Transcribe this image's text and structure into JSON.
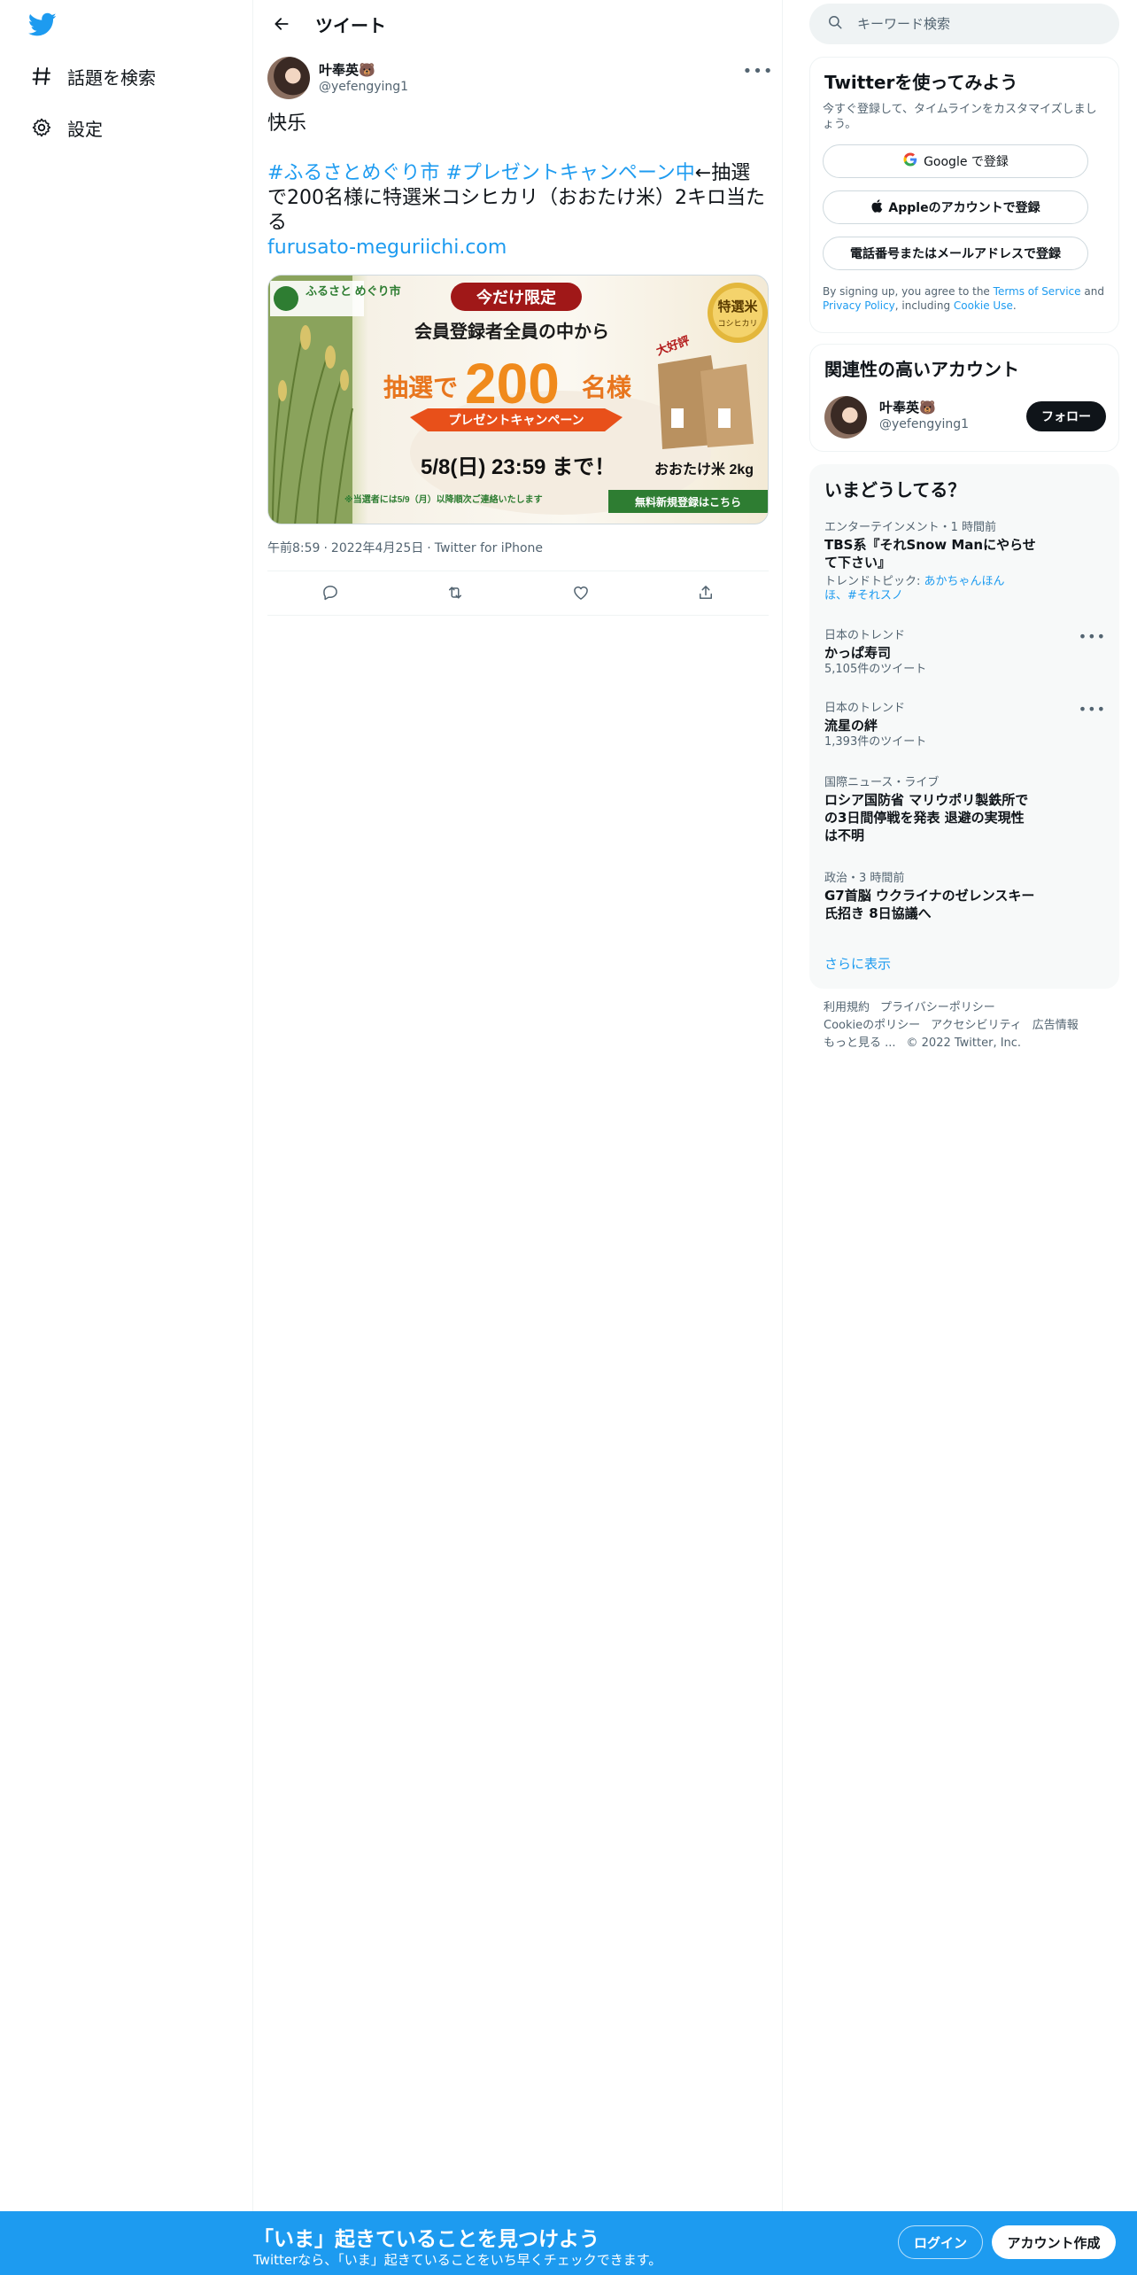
{
  "colors": {
    "brand": "#1d9bf0",
    "text": "#0f1419",
    "muted": "#536471",
    "border": "#eff3f4"
  },
  "nav": {
    "logo_icon": "twitter-bird-icon",
    "items": [
      {
        "icon": "hashtag-icon",
        "label": "話題を検索"
      },
      {
        "icon": "gear-icon",
        "label": "設定"
      }
    ]
  },
  "header": {
    "back_icon": "arrow-left-icon",
    "title": "ツイート"
  },
  "tweet": {
    "author_name": "叶奉英🐻",
    "author_handle": "@yefengying1",
    "more_icon": "more-icon",
    "line1": "快乐",
    "hashtag1": "#ふるさとめぐり市",
    "hashtag2": "#プレゼントキャンペーン中",
    "body_rest": "←抽選で200名様に特選米コシヒカリ（おおたけ米）2キロ当たる",
    "link": "furusato-meguriichi.com",
    "image": {
      "logo": "ふるさと\nめぐり市",
      "banner_top": "今だけ限定",
      "headline": "会員登録者全員の中から",
      "lottery_prefix": "抽選で",
      "lottery_number": "200",
      "lottery_suffix": "名様",
      "ribbon": "プレゼントキャンペーン",
      "badge_main": "特選米",
      "badge_sub": "コシヒカリ",
      "popular": "大好評",
      "deadline": "5/8(日) 23:59 まで！",
      "product": "おおたけ米 2kg",
      "notice": "※当選者には5/9（月）以降順次ご連絡いたします",
      "cta": "無料新規登録はこちら"
    },
    "time": "午前8:59",
    "date": "2022年4月25日",
    "source": "Twitter for iPhone",
    "actions": [
      "reply-icon",
      "retweet-icon",
      "like-icon",
      "share-icon"
    ]
  },
  "search": {
    "placeholder": "キーワード検索",
    "icon": "search-icon"
  },
  "signup": {
    "title": "Twitterを使ってみよう",
    "subtitle": "今すぐ登録して、タイムラインをカスタマイズしましょう。",
    "google": "Google で登録",
    "apple": "Appleのアカウントで登録",
    "phone": "電話番号またはメールアドレスで登録",
    "legal_prefix": "By signing up, you agree to the",
    "tos": "Terms of Service",
    "and": "and",
    "privacy": "Privacy Policy",
    "including": ", including",
    "cookie": "Cookie Use",
    "dot": "."
  },
  "related": {
    "title": "関連性の高いアカウント",
    "name": "叶奉英🐻",
    "handle": "@yefengying1",
    "follow": "フォロー"
  },
  "trends": {
    "title": "いまどうしてる？",
    "items": [
      {
        "category": "エンターテインメント・1 時間前",
        "name": "TBS系『それSnow Manにやらせて下さい』",
        "topic_prefix": "トレンドトピック: ",
        "topic_links": "あかちゃんほんほ、#それスノ"
      },
      {
        "category": "日本のトレンド",
        "name": "かっぱ寿司",
        "count": "5,105件のツイート"
      },
      {
        "category": "日本のトレンド",
        "name": "流星の絆",
        "count": "1,393件のツイート"
      },
      {
        "category": "国際ニュース・ライブ",
        "name": "ロシア国防省 マリウポリ製鉄所での3日間停戦を発表 退避の実現性は不明"
      },
      {
        "category": "政治・3 時間前",
        "name": "G7首脳 ウクライナのゼレンスキー氏招き 8日協議へ"
      }
    ],
    "show_more": "さらに表示"
  },
  "footer": {
    "terms": "利用規約",
    "privacy": "プライバシーポリシー",
    "cookie": "Cookieのポリシー",
    "accessibility": "アクセシビリティ",
    "ads": "広告情報",
    "more": "もっと見る ...",
    "copyright": "© 2022 Twitter, Inc."
  },
  "bottom_bar": {
    "title": "「いま」起きていることを見つけよう",
    "subtitle": "Twitterなら、「いま」起きていることをいち早くチェックできます。",
    "login": "ログイン",
    "signup": "アカウント作成"
  }
}
